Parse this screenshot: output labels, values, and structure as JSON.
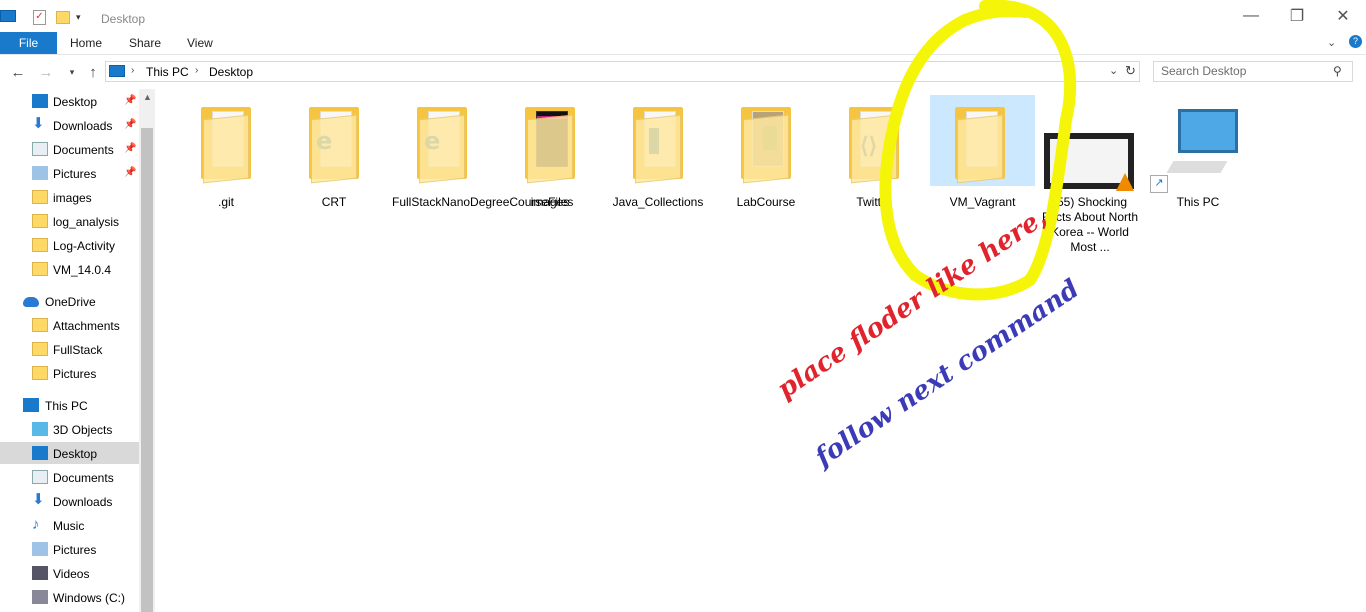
{
  "window": {
    "title": "Desktop",
    "minimize": "—",
    "restore": "❐",
    "close": "✕"
  },
  "ribbon": {
    "file": "File",
    "tabs": [
      "Home",
      "Share",
      "View"
    ]
  },
  "address": {
    "crumbs": [
      "This PC",
      "Desktop"
    ],
    "search_placeholder": "Search Desktop"
  },
  "sidebar": {
    "quick_access": [
      {
        "label": "Desktop",
        "icon": "desktop-icon",
        "pinned": true
      },
      {
        "label": "Downloads",
        "icon": "downloads-icon",
        "pinned": true
      },
      {
        "label": "Documents",
        "icon": "documents-icon",
        "pinned": true
      },
      {
        "label": "Pictures",
        "icon": "pictures-icon",
        "pinned": true
      },
      {
        "label": "images",
        "icon": "folder-icon"
      },
      {
        "label": "log_analysis",
        "icon": "folder-icon"
      },
      {
        "label": "Log-Activity",
        "icon": "folder-icon"
      },
      {
        "label": "VM_14.0.4",
        "icon": "folder-icon"
      }
    ],
    "onedrive": {
      "label": "OneDrive",
      "items": [
        "Attachments",
        "FullStack",
        "Pictures"
      ]
    },
    "this_pc": {
      "label": "This PC",
      "items": [
        {
          "label": "3D Objects",
          "icon": "3d-objects-icon"
        },
        {
          "label": "Desktop",
          "icon": "desktop-icon",
          "selected": true
        },
        {
          "label": "Documents",
          "icon": "documents-icon"
        },
        {
          "label": "Downloads",
          "icon": "downloads-icon"
        },
        {
          "label": "Music",
          "icon": "music-icon"
        },
        {
          "label": "Pictures",
          "icon": "pictures-icon"
        },
        {
          "label": "Videos",
          "icon": "videos-icon"
        },
        {
          "label": "Windows (C:)",
          "icon": "drive-icon"
        }
      ]
    }
  },
  "items": [
    {
      "name": ".git",
      "kind": "folder"
    },
    {
      "name": "CRT",
      "kind": "folder-edge"
    },
    {
      "name": "FullStackNanoDegreeCourseFiles",
      "kind": "folder-edge"
    },
    {
      "name": "images",
      "kind": "folder-dark"
    },
    {
      "name": "Java_Collections",
      "kind": "folder-doc"
    },
    {
      "name": "LabCourse",
      "kind": "folder-photo"
    },
    {
      "name": "Twitter",
      "kind": "folder-vs"
    },
    {
      "name": "VM_Vagrant",
      "kind": "folder",
      "selected": true
    },
    {
      "name": "(55) Shocking Facts About North Korea -- World Most ...",
      "kind": "video"
    },
    {
      "name": "This PC",
      "kind": "computer"
    }
  ],
  "annotations": {
    "line1": "place floder like here,",
    "line2": "follow next command",
    "line1_color": "#e0232c",
    "line2_color": "#3b3bb8",
    "circle_color": "#f5f50a"
  },
  "colors": {
    "accent": "#1979ca",
    "selection": "#cce8ff"
  }
}
